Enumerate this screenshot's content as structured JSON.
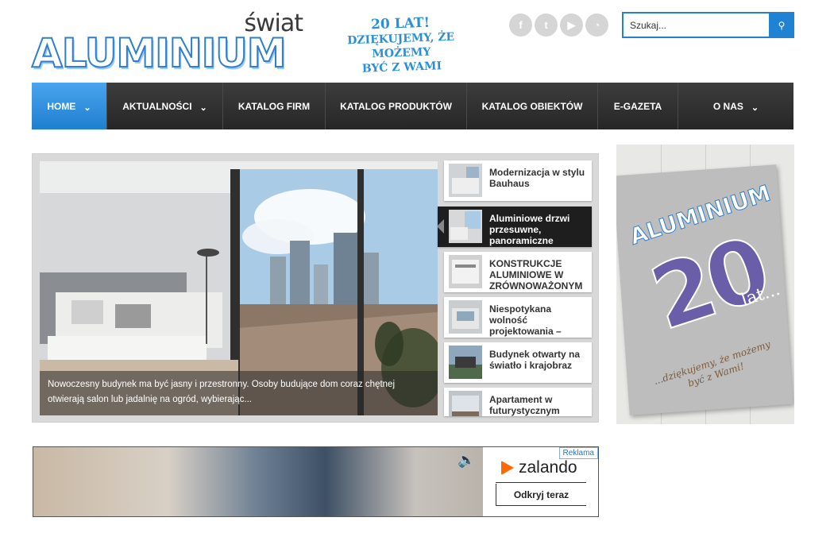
{
  "header": {
    "logo_top": "świat",
    "logo_main": "ALUMINIUM",
    "badge_line1": "20 LAT!",
    "badge_line2": "DZIĘKUJEMY, ŻE MOŻEMY",
    "badge_line3": "BYĆ Z WAMI",
    "socials": [
      {
        "icon": "facebook-icon",
        "glyph": "f"
      },
      {
        "icon": "twitter-icon",
        "glyph": "t"
      },
      {
        "icon": "youtube-icon",
        "glyph": "▶"
      },
      {
        "icon": "rss-icon",
        "glyph": "◔"
      }
    ],
    "search": {
      "placeholder": "Szukaj...",
      "button_icon": "search-icon"
    }
  },
  "nav": {
    "items": [
      {
        "label": "HOME",
        "has_dropdown": true,
        "active": true
      },
      {
        "label": "AKTUALNOŚCI",
        "has_dropdown": true,
        "active": false
      },
      {
        "label": "KATALOG FIRM",
        "has_dropdown": false,
        "active": false
      },
      {
        "label": "KATALOG PRODUKTÓW",
        "has_dropdown": false,
        "active": false
      },
      {
        "label": "KATALOG OBIEKTÓW",
        "has_dropdown": false,
        "active": false
      },
      {
        "label": "E-GAZETA",
        "has_dropdown": false,
        "active": false
      },
      {
        "label": "O NAS",
        "has_dropdown": true,
        "active": false
      }
    ]
  },
  "slider": {
    "caption": "Nowoczesny budynek ma być jasny i przestronny. Osoby budujące dom coraz chętnej otwierają salon lub jadalnię na ogród, wybierając...",
    "thumbs": [
      {
        "title": "Modernizacja w stylu Bauhaus",
        "active": false
      },
      {
        "title": "Aluminiowe drzwi przesuwne, panoramiczne",
        "active": true
      },
      {
        "title": "KONSTRUKCJE ALUMINIOWE W ZRÓWNOWAŻONYM",
        "active": false
      },
      {
        "title": "Niespotykana wolność projektowania –",
        "active": false
      },
      {
        "title": "Budynek otwarty na światło i krajobraz",
        "active": false
      },
      {
        "title": "Apartament w futurystycznym",
        "active": false
      }
    ]
  },
  "side_ad": {
    "mag_title": "ALUMINIUM",
    "mag_number": "20",
    "mag_lat": "lat...",
    "mag_thanks": "...dziękujemy, że możemy być z Wami!"
  },
  "banner": {
    "reklama": "Reklama",
    "brand": "zalando",
    "cta": "Odkryj teraz"
  }
}
